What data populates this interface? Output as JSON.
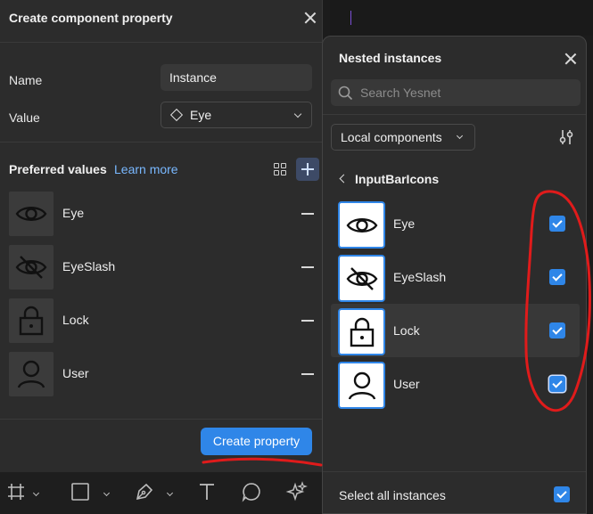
{
  "left_panel": {
    "title": "Create component property",
    "name_label": "Name",
    "name_value": "Instance",
    "value_label": "Value",
    "value_selected": "Eye",
    "preferred_values_label": "Preferred values",
    "learn_more": "Learn more",
    "items": [
      {
        "label": "Eye",
        "icon": "eye-icon"
      },
      {
        "label": "EyeSlash",
        "icon": "eye-slash-icon"
      },
      {
        "label": "Lock",
        "icon": "lock-icon"
      },
      {
        "label": "User",
        "icon": "user-icon"
      }
    ],
    "create_button": "Create property"
  },
  "toolbar": {
    "tools": [
      "frame-icon",
      "rectangle-icon",
      "pen-icon",
      "text-icon",
      "comment-icon",
      "actions-icon"
    ]
  },
  "right_panel": {
    "title": "Nested instances",
    "search_placeholder": "Search Yesnet",
    "library_select": "Local components",
    "folder": "InputBarIcons",
    "items": [
      {
        "label": "Eye",
        "icon": "eye-icon",
        "checked": true
      },
      {
        "label": "EyeSlash",
        "icon": "eye-slash-icon",
        "checked": true
      },
      {
        "label": "Lock",
        "icon": "lock-icon",
        "checked": true
      },
      {
        "label": "User",
        "icon": "user-icon",
        "checked": true
      }
    ],
    "select_all_label": "Select all instances",
    "select_all_checked": true
  },
  "colors": {
    "accent": "#2f86e8",
    "panel_bg": "#2c2c2c",
    "link": "#79b8ff",
    "annotation": "#e01b1b"
  }
}
